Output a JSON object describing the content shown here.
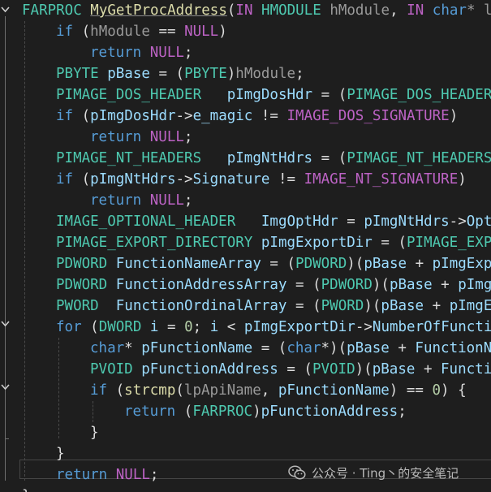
{
  "code_lines": [
    [
      [
        "FARPROC ",
        "ty"
      ],
      [
        "MyGetProcAddress",
        "fn-ul"
      ],
      [
        "(",
        "pl"
      ],
      [
        "IN ",
        "mac"
      ],
      [
        "HMODULE ",
        "ty"
      ],
      [
        "hModule",
        "par"
      ],
      [
        ", ",
        "pl"
      ],
      [
        "IN ",
        "mac"
      ],
      [
        "char",
        "kw"
      ],
      [
        "* lp",
        "par"
      ]
    ],
    [
      [
        "if ",
        "kw"
      ],
      [
        "(",
        "pl"
      ],
      [
        "hModule",
        "par"
      ],
      [
        " == ",
        "pl"
      ],
      [
        "NULL",
        "mac"
      ],
      [
        ")",
        "pl"
      ]
    ],
    [
      [
        "return ",
        "kw"
      ],
      [
        "NULL",
        "mac"
      ],
      [
        ";",
        "pl"
      ]
    ],
    [
      [
        "PBYTE ",
        "ty"
      ],
      [
        "pBase",
        "var"
      ],
      [
        " = (",
        "pl"
      ],
      [
        "PBYTE",
        "ty"
      ],
      [
        ")",
        "pl"
      ],
      [
        "hModule",
        "par"
      ],
      [
        ";",
        "pl"
      ]
    ],
    [
      [
        "PIMAGE_DOS_HEADER ",
        "ty"
      ],
      [
        "  pImgDosHdr",
        "var"
      ],
      [
        " = (",
        "pl"
      ],
      [
        "PIMAGE_DOS_HEADER",
        "ty"
      ]
    ],
    [
      [
        "if ",
        "kw"
      ],
      [
        "(",
        "pl"
      ],
      [
        "pImgDosHdr",
        "var"
      ],
      [
        "->",
        "pl"
      ],
      [
        "e_magic",
        "var"
      ],
      [
        " != ",
        "pl"
      ],
      [
        "IMAGE_DOS_SIGNATURE",
        "mac"
      ],
      [
        ")",
        "pl"
      ]
    ],
    [
      [
        "return ",
        "kw"
      ],
      [
        "NULL",
        "mac"
      ],
      [
        ";",
        "pl"
      ]
    ],
    [
      [
        "PIMAGE_NT_HEADERS ",
        "ty"
      ],
      [
        "  pImgNtHdrs",
        "var"
      ],
      [
        " = (",
        "pl"
      ],
      [
        "PIMAGE_NT_HEADERS",
        "ty"
      ],
      [
        ")",
        "pl"
      ]
    ],
    [
      [
        "if ",
        "kw"
      ],
      [
        "(",
        "pl"
      ],
      [
        "pImgNtHdrs",
        "var"
      ],
      [
        "->",
        "pl"
      ],
      [
        "Signature",
        "var"
      ],
      [
        " != ",
        "pl"
      ],
      [
        "IMAGE_NT_SIGNATURE",
        "mac"
      ],
      [
        ")",
        "pl"
      ]
    ],
    [
      [
        "return ",
        "kw"
      ],
      [
        "NULL",
        "mac"
      ],
      [
        ";",
        "pl"
      ]
    ],
    [
      [
        "IMAGE_OPTIONAL_HEADER ",
        "ty"
      ],
      [
        "  ImgOptHdr",
        "var"
      ],
      [
        " = ",
        "pl"
      ],
      [
        "pImgNtHdrs",
        "var"
      ],
      [
        "->",
        "pl"
      ],
      [
        "Opti",
        "var"
      ]
    ],
    [
      [
        "PIMAGE_EXPORT_DIRECTORY ",
        "ty"
      ],
      [
        "pImgExportDir",
        "var"
      ],
      [
        " = (",
        "pl"
      ],
      [
        "PIMAGE_EXPO",
        "ty"
      ]
    ],
    [
      [
        "PDWORD ",
        "ty"
      ],
      [
        "FunctionNameArray",
        "var"
      ],
      [
        " = (",
        "pl"
      ],
      [
        "PDWORD",
        "ty"
      ],
      [
        ")(",
        "pl"
      ],
      [
        "pBase",
        "var"
      ],
      [
        " + ",
        "pl"
      ],
      [
        "pImgExpo",
        "var"
      ]
    ],
    [
      [
        "PDWORD ",
        "ty"
      ],
      [
        "FunctionAddressArray",
        "var"
      ],
      [
        " = (",
        "pl"
      ],
      [
        "PDWORD",
        "ty"
      ],
      [
        ")(",
        "pl"
      ],
      [
        "pBase",
        "var"
      ],
      [
        " + ",
        "pl"
      ],
      [
        "pImgE",
        "var"
      ]
    ],
    [
      [
        "PWORD ",
        "ty"
      ],
      [
        " FunctionOrdinalArray",
        "var"
      ],
      [
        " = (",
        "pl"
      ],
      [
        "PWORD",
        "ty"
      ],
      [
        ")(",
        "pl"
      ],
      [
        "pBase",
        "var"
      ],
      [
        " + ",
        "pl"
      ],
      [
        "pImgEx",
        "var"
      ]
    ],
    [
      [
        "for ",
        "kw"
      ],
      [
        "(",
        "pl"
      ],
      [
        "DWORD ",
        "ty"
      ],
      [
        "i",
        "var"
      ],
      [
        " = ",
        "pl"
      ],
      [
        "0",
        "num"
      ],
      [
        "; ",
        "pl"
      ],
      [
        "i",
        "var"
      ],
      [
        " < ",
        "pl"
      ],
      [
        "pImgExportDir",
        "var"
      ],
      [
        "->",
        "pl"
      ],
      [
        "NumberOfFunctio",
        "var"
      ]
    ],
    [
      [
        "char",
        "kw"
      ],
      [
        "* ",
        "pl"
      ],
      [
        "pFunctionName",
        "var"
      ],
      [
        " = (",
        "pl"
      ],
      [
        "char",
        "kw"
      ],
      [
        "*)(",
        "pl"
      ],
      [
        "pBase",
        "var"
      ],
      [
        " + ",
        "pl"
      ],
      [
        "FunctionNa",
        "var"
      ]
    ],
    [
      [
        "PVOID ",
        "ty"
      ],
      [
        "pFunctionAddress",
        "var"
      ],
      [
        " = (",
        "pl"
      ],
      [
        "PVOID",
        "ty"
      ],
      [
        ")(",
        "pl"
      ],
      [
        "pBase",
        "var"
      ],
      [
        " + ",
        "pl"
      ],
      [
        "Functio",
        "var"
      ]
    ],
    [
      [
        "if ",
        "kw"
      ],
      [
        "(",
        "pl"
      ],
      [
        "strcmp",
        "fn"
      ],
      [
        "(",
        "pl"
      ],
      [
        "lpApiName",
        "par"
      ],
      [
        ", ",
        "pl"
      ],
      [
        "pFunctionName",
        "var"
      ],
      [
        ") == ",
        "pl"
      ],
      [
        "0",
        "num"
      ],
      [
        ") {",
        "pl"
      ]
    ],
    [
      [
        "return ",
        "kw"
      ],
      [
        "(",
        "pl"
      ],
      [
        "FARPROC",
        "ty"
      ],
      [
        ")",
        "pl"
      ],
      [
        "pFunctionAddress",
        "var"
      ],
      [
        ";",
        "pl"
      ]
    ],
    [
      [
        "}",
        "pl"
      ]
    ],
    [
      [
        "}",
        "pl"
      ]
    ],
    [
      [
        "return ",
        "kw"
      ],
      [
        "NULL",
        "mac"
      ],
      [
        ";",
        "pl"
      ]
    ],
    [
      [
        "}",
        "pl"
      ]
    ]
  ],
  "colors": {
    "background": "#1e1e1e",
    "keyword": "#569cd6",
    "type": "#4ec9b0",
    "macro": "#bd63c5",
    "function": "#dcdcaa",
    "parameter": "#9a9a9a",
    "variable": "#9cdcfe",
    "number": "#b5cea8",
    "plain": "#dcdcdc"
  },
  "watermark": {
    "icon": "wechat-icon",
    "text": "公众号 · Ting丶的安全笔记"
  }
}
